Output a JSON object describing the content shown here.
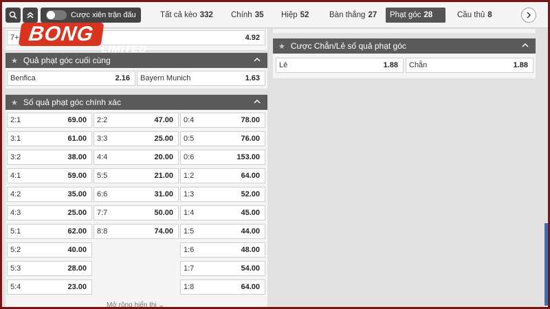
{
  "nav": {
    "toggle_label": "Cược xiên trận đấu",
    "tabs": [
      {
        "label": "Tất cả kèo",
        "count": "332"
      },
      {
        "label": "Chính",
        "count": "35"
      },
      {
        "label": "Hiệp",
        "count": "52"
      },
      {
        "label": "Bàn thắng",
        "count": "27"
      },
      {
        "label": "Phạt góc",
        "count": "28"
      },
      {
        "label": "Cầu thủ",
        "count": "8"
      }
    ]
  },
  "logo": {
    "text": "BONG",
    "sub": "LIMITED"
  },
  "top_row": {
    "label": "7+",
    "value": "4.92"
  },
  "last_corner": {
    "title": "Quả phạt góc cuối cùng",
    "options": [
      {
        "label": "Benfica",
        "value": "2.16"
      },
      {
        "label": "Bayern Munich",
        "value": "1.63"
      }
    ]
  },
  "exact_corners": {
    "title": "Số quả phạt góc chính xác",
    "col1": [
      {
        "label": "2:1",
        "value": "69.00"
      },
      {
        "label": "3:1",
        "value": "61.00"
      },
      {
        "label": "3:2",
        "value": "38.00"
      },
      {
        "label": "4:1",
        "value": "59.00"
      },
      {
        "label": "4:2",
        "value": "35.00"
      },
      {
        "label": "4:3",
        "value": "25.00"
      },
      {
        "label": "5:1",
        "value": "62.00"
      },
      {
        "label": "5:2",
        "value": "40.00"
      },
      {
        "label": "5:3",
        "value": "28.00"
      },
      {
        "label": "5:4",
        "value": "23.00"
      }
    ],
    "col2": [
      {
        "label": "2:2",
        "value": "47.00"
      },
      {
        "label": "3:3",
        "value": "25.00"
      },
      {
        "label": "4:4",
        "value": "20.00"
      },
      {
        "label": "5:5",
        "value": "21.00"
      },
      {
        "label": "6:6",
        "value": "31.00"
      },
      {
        "label": "7:7",
        "value": "50.00"
      },
      {
        "label": "8:8",
        "value": "74.00"
      }
    ],
    "col3": [
      {
        "label": "0:4",
        "value": "78.00"
      },
      {
        "label": "0:5",
        "value": "76.00"
      },
      {
        "label": "0:6",
        "value": "153.00"
      },
      {
        "label": "1:2",
        "value": "64.00"
      },
      {
        "label": "1:3",
        "value": "52.00"
      },
      {
        "label": "1:4",
        "value": "45.00"
      },
      {
        "label": "1:5",
        "value": "44.00"
      },
      {
        "label": "1:6",
        "value": "48.00"
      },
      {
        "label": "1:7",
        "value": "54.00"
      },
      {
        "label": "1:8",
        "value": "64.00"
      }
    ],
    "more_label": "Mở rộng hiển thị"
  },
  "odd_even": {
    "title": "Cược Chẵn/Lẻ số quả phạt góc",
    "options": [
      {
        "label": "Lẻ",
        "value": "1.88"
      },
      {
        "label": "Chẵn",
        "value": "1.88"
      }
    ]
  }
}
